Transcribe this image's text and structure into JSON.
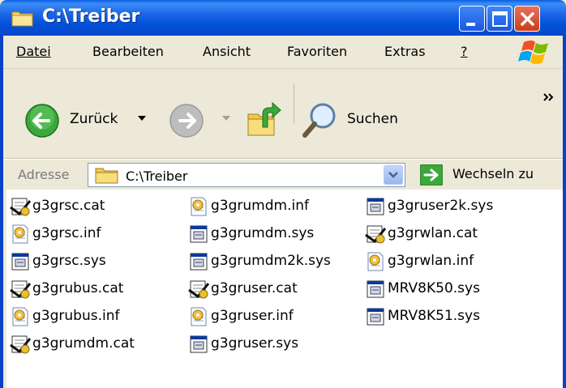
{
  "window": {
    "title": "C:\\Treiber"
  },
  "menu": [
    {
      "label": "Datei",
      "mnemonic": "D"
    },
    {
      "label": "Bearbeiten",
      "mnemonic": "B"
    },
    {
      "label": "Ansicht",
      "mnemonic": "A"
    },
    {
      "label": "Favoriten",
      "mnemonic": "F"
    },
    {
      "label": "Extras",
      "mnemonic": "x"
    },
    {
      "label": "?",
      "mnemonic": "?"
    }
  ],
  "toolbar": {
    "back_label": "Zurück",
    "search_label": "Suchen"
  },
  "address": {
    "label": "Adresse",
    "value": "C:\\Treiber",
    "go_label": "Wechseln zu"
  },
  "files": [
    {
      "name": "g3grsc.cat",
      "type": "cat"
    },
    {
      "name": "g3grsc.inf",
      "type": "inf"
    },
    {
      "name": "g3grsc.sys",
      "type": "sys"
    },
    {
      "name": "g3grubus.cat",
      "type": "cat"
    },
    {
      "name": "g3grubus.inf",
      "type": "inf"
    },
    {
      "name": "g3grumdm.cat",
      "type": "cat"
    },
    {
      "name": "g3grumdm.inf",
      "type": "inf"
    },
    {
      "name": "g3grumdm.sys",
      "type": "sys"
    },
    {
      "name": "g3grumdm2k.sys",
      "type": "sys"
    },
    {
      "name": "g3gruser.cat",
      "type": "cat"
    },
    {
      "name": "g3gruser.inf",
      "type": "inf"
    },
    {
      "name": "g3gruser.sys",
      "type": "sys"
    },
    {
      "name": "g3gruser2k.sys",
      "type": "sys"
    },
    {
      "name": "g3grwlan.cat",
      "type": "cat"
    },
    {
      "name": "g3grwlan.inf",
      "type": "inf"
    },
    {
      "name": "MRV8K50.sys",
      "type": "sys"
    },
    {
      "name": "MRV8K51.sys",
      "type": "sys"
    }
  ]
}
